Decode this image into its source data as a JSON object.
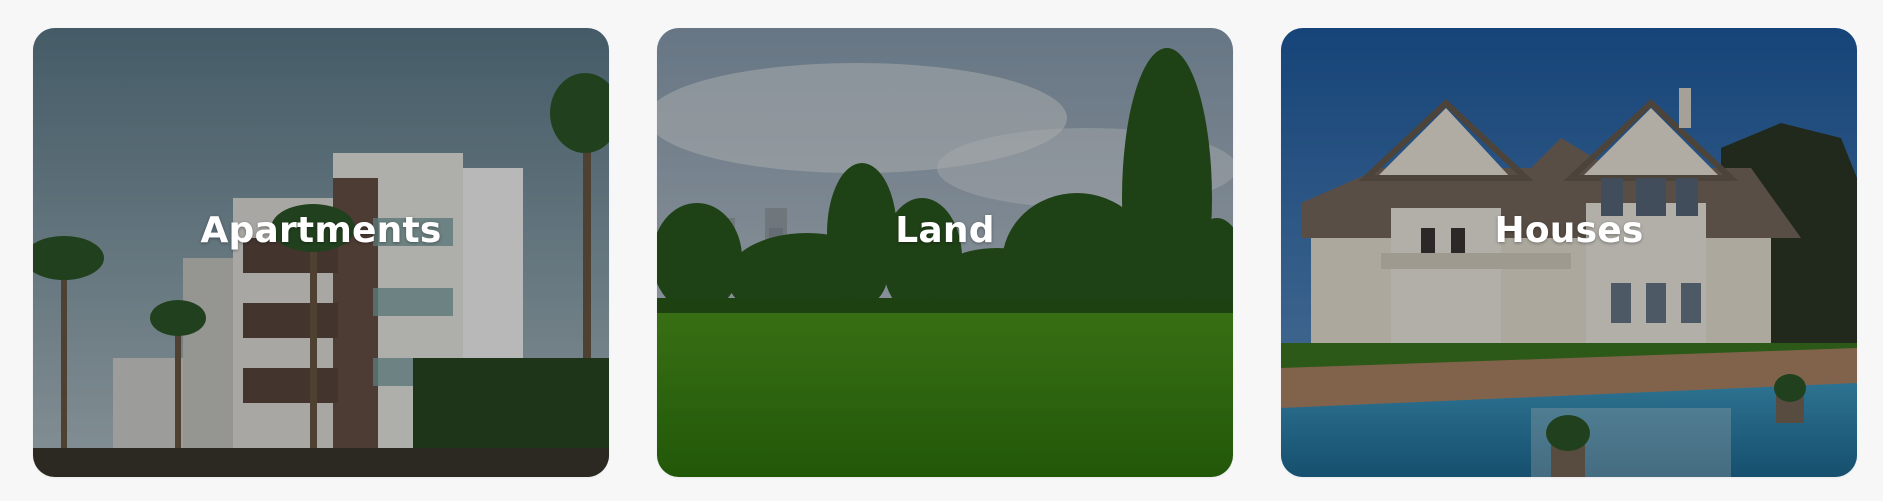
{
  "categories": [
    {
      "title": "Apartments",
      "image": "apartments-photo"
    },
    {
      "title": "Land",
      "image": "land-photo"
    },
    {
      "title": "Houses",
      "image": "houses-photo"
    }
  ],
  "colors": {
    "page_background": "#f7f7f8",
    "title_text": "#ffffff",
    "overlay": "rgba(0,0,0,0.28)"
  }
}
